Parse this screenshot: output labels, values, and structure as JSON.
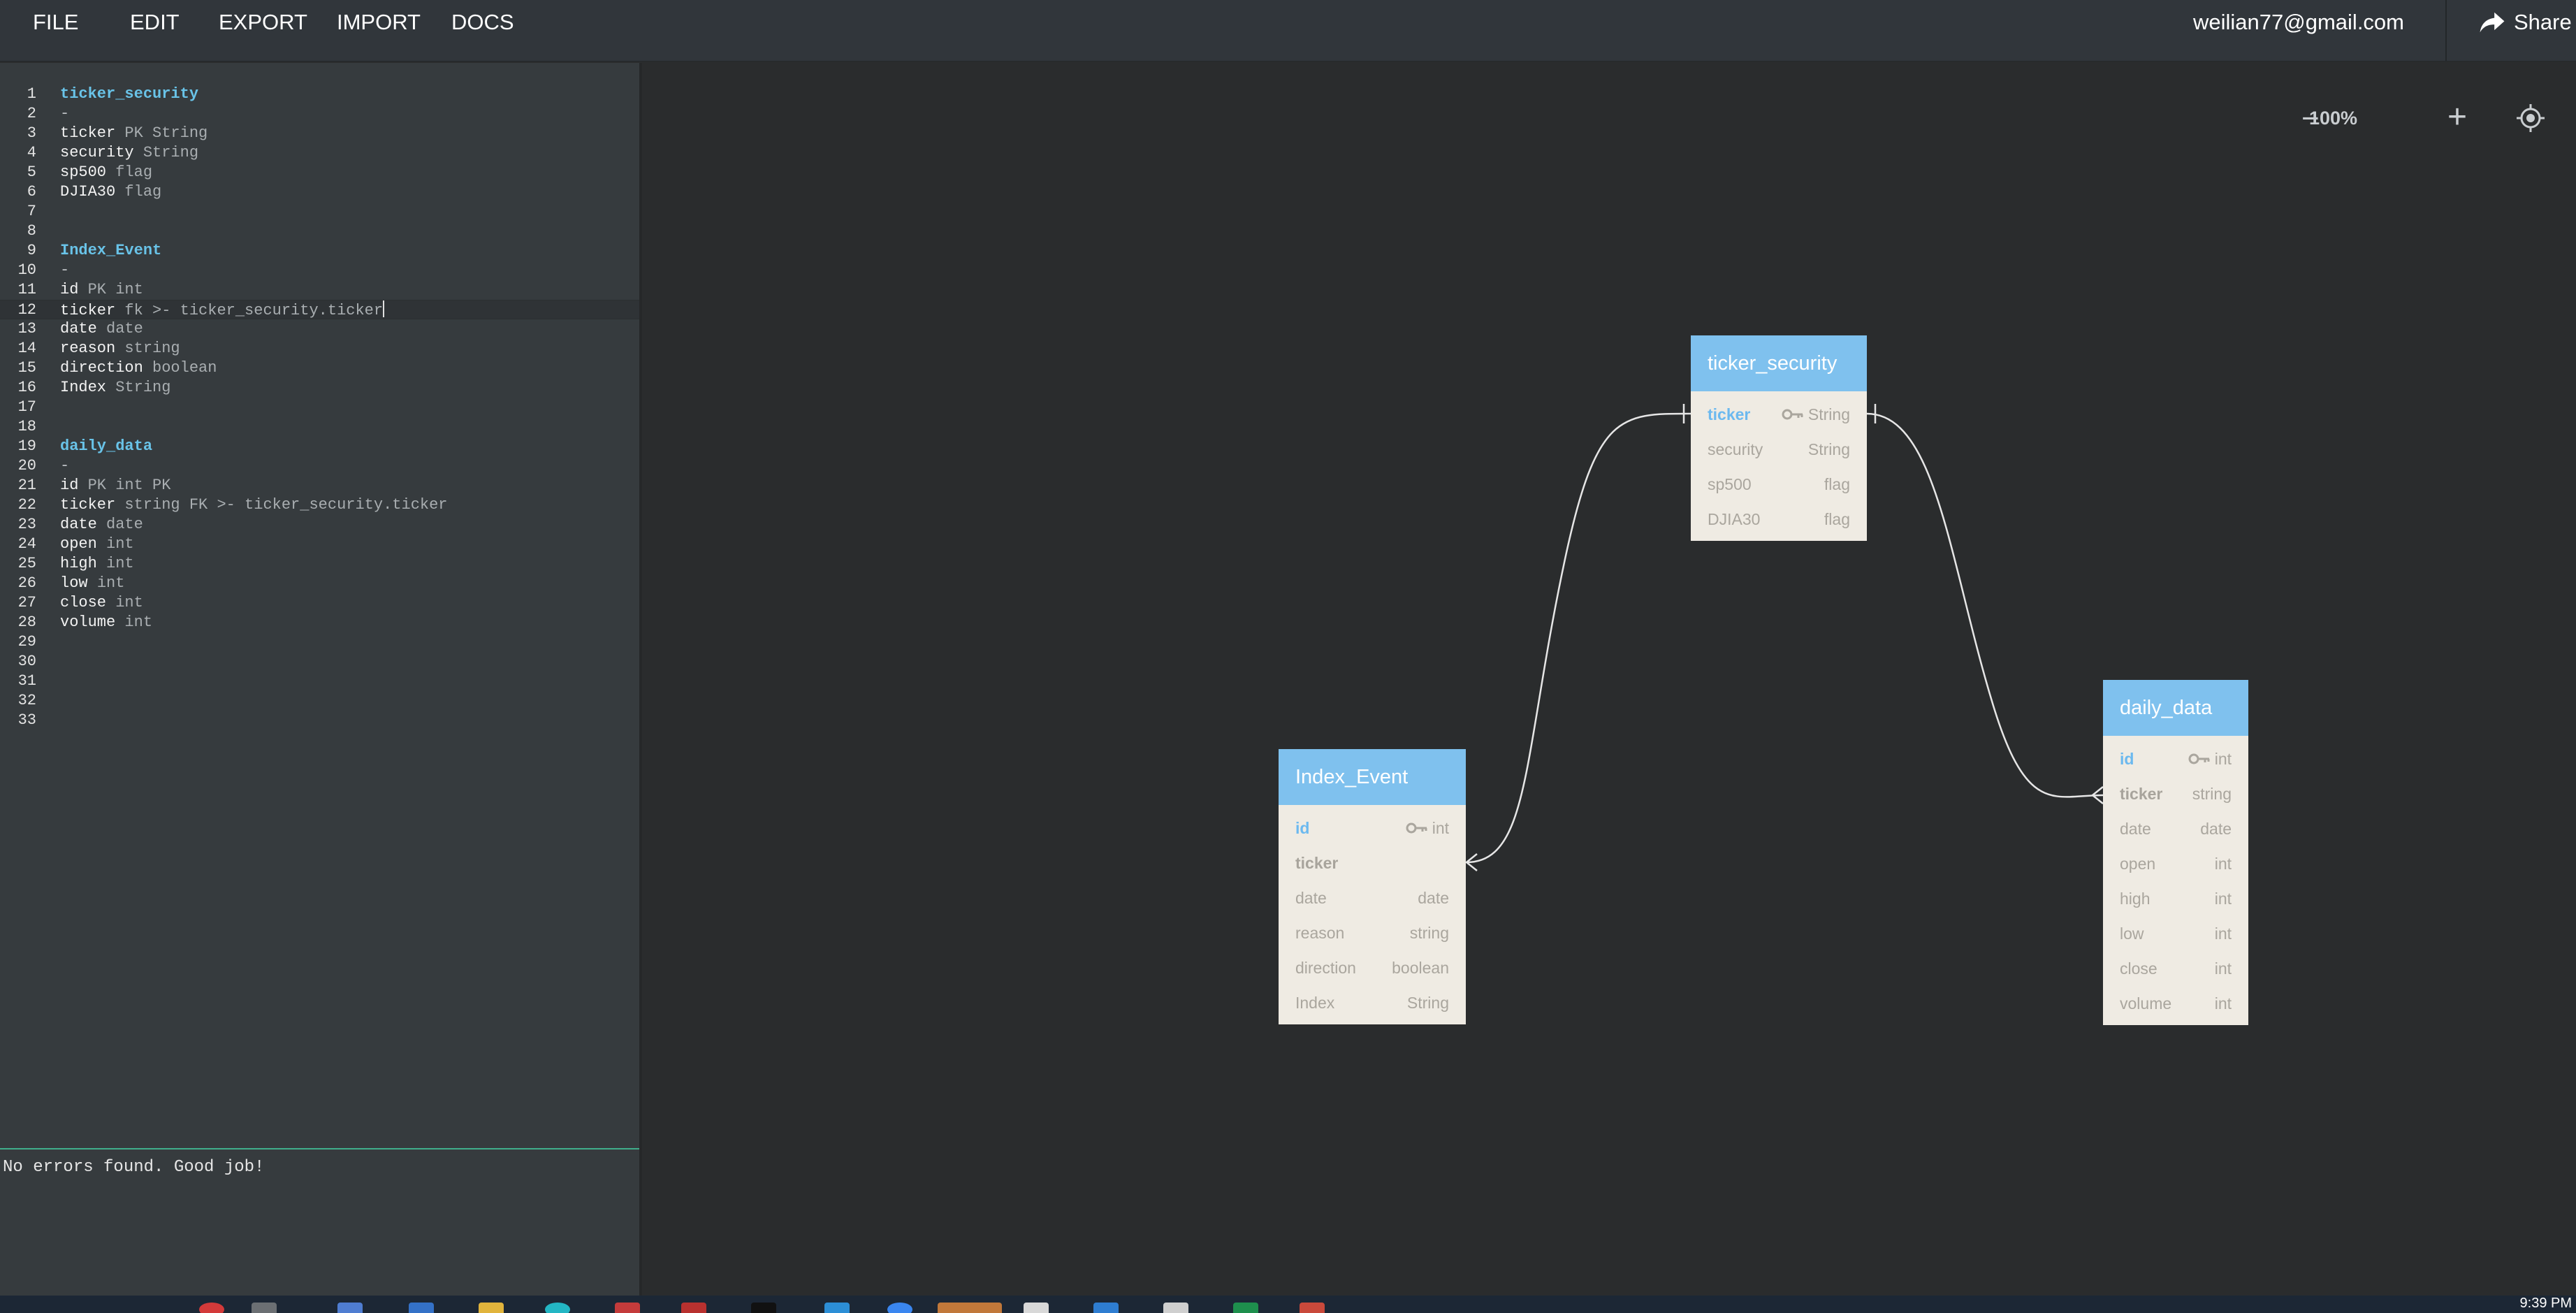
{
  "menu": {
    "file": "FILE",
    "edit": "EDIT",
    "export": "EXPORT",
    "import": "IMPORT",
    "docs": "DOCS"
  },
  "user": {
    "email": "weilian77@gmail.com"
  },
  "share": {
    "label": "Share",
    "icon": "share-arrow-icon"
  },
  "editor": {
    "lines": [
      {
        "n": "1",
        "parts": [
          [
            "tbl",
            "ticker_security"
          ]
        ]
      },
      {
        "n": "2",
        "parts": [
          [
            "sep",
            "-"
          ]
        ]
      },
      {
        "n": "3",
        "parts": [
          [
            "txt",
            "ticker "
          ],
          [
            "dim",
            "PK String"
          ]
        ]
      },
      {
        "n": "4",
        "parts": [
          [
            "txt",
            "security "
          ],
          [
            "dim",
            "String"
          ]
        ]
      },
      {
        "n": "5",
        "parts": [
          [
            "txt",
            "sp500 "
          ],
          [
            "dim",
            "flag"
          ]
        ]
      },
      {
        "n": "6",
        "parts": [
          [
            "txt",
            "DJIA30 "
          ],
          [
            "dim",
            "flag"
          ]
        ]
      },
      {
        "n": "7",
        "parts": []
      },
      {
        "n": "8",
        "parts": []
      },
      {
        "n": "9",
        "parts": [
          [
            "tbl",
            "Index_Event"
          ]
        ]
      },
      {
        "n": "10",
        "parts": [
          [
            "sep",
            "-"
          ]
        ]
      },
      {
        "n": "11",
        "parts": [
          [
            "txt",
            "id "
          ],
          [
            "dim",
            "PK int"
          ]
        ]
      },
      {
        "n": "12",
        "parts": [
          [
            "txt",
            "ticker "
          ],
          [
            "dim",
            "fk >- ticker_security.ticker"
          ]
        ],
        "active": true
      },
      {
        "n": "13",
        "parts": [
          [
            "txt",
            "date "
          ],
          [
            "dim",
            "date"
          ]
        ]
      },
      {
        "n": "14",
        "parts": [
          [
            "txt",
            "reason "
          ],
          [
            "dim",
            "string"
          ]
        ]
      },
      {
        "n": "15",
        "parts": [
          [
            "txt",
            "direction "
          ],
          [
            "dim",
            "boolean"
          ]
        ]
      },
      {
        "n": "16",
        "parts": [
          [
            "txt",
            "Index "
          ],
          [
            "dim",
            "String"
          ]
        ]
      },
      {
        "n": "17",
        "parts": []
      },
      {
        "n": "18",
        "parts": []
      },
      {
        "n": "19",
        "parts": [
          [
            "tbl",
            "daily_data"
          ]
        ]
      },
      {
        "n": "20",
        "parts": [
          [
            "sep",
            "-"
          ]
        ]
      },
      {
        "n": "21",
        "parts": [
          [
            "txt",
            "id "
          ],
          [
            "dim",
            "PK int PK"
          ]
        ]
      },
      {
        "n": "22",
        "parts": [
          [
            "txt",
            "ticker "
          ],
          [
            "dim",
            "string FK >- ticker_security.ticker"
          ]
        ]
      },
      {
        "n": "23",
        "parts": [
          [
            "txt",
            "date "
          ],
          [
            "dim",
            "date"
          ]
        ]
      },
      {
        "n": "24",
        "parts": [
          [
            "txt",
            "open "
          ],
          [
            "dim",
            "int"
          ]
        ]
      },
      {
        "n": "25",
        "parts": [
          [
            "txt",
            "high "
          ],
          [
            "dim",
            "int"
          ]
        ]
      },
      {
        "n": "26",
        "parts": [
          [
            "txt",
            "low "
          ],
          [
            "dim",
            "int"
          ]
        ]
      },
      {
        "n": "27",
        "parts": [
          [
            "txt",
            "close "
          ],
          [
            "dim",
            "int"
          ]
        ]
      },
      {
        "n": "28",
        "parts": [
          [
            "txt",
            "volume "
          ],
          [
            "dim",
            "int"
          ]
        ]
      },
      {
        "n": "29",
        "parts": []
      },
      {
        "n": "30",
        "parts": []
      },
      {
        "n": "31",
        "parts": []
      },
      {
        "n": "32",
        "parts": []
      },
      {
        "n": "33",
        "parts": []
      }
    ]
  },
  "status": {
    "message": "No errors found. Good job!"
  },
  "zoom": {
    "level": "100%",
    "minus": "−",
    "plus": "+",
    "locate_icon": "locate-icon"
  },
  "tables": {
    "ticker_security": {
      "title": "ticker_security",
      "rows": [
        {
          "field": "ticker",
          "type": "String",
          "pk": true
        },
        {
          "field": "security",
          "type": "String"
        },
        {
          "field": "sp500",
          "type": "flag"
        },
        {
          "field": "DJIA30",
          "type": "flag"
        }
      ]
    },
    "index_event": {
      "title": "Index_Event",
      "rows": [
        {
          "field": "id",
          "type": "int",
          "pk": true
        },
        {
          "field": "ticker",
          "type": "",
          "fk": true
        },
        {
          "field": "date",
          "type": "date"
        },
        {
          "field": "reason",
          "type": "string"
        },
        {
          "field": "direction",
          "type": "boolean"
        },
        {
          "field": "Index",
          "type": "String"
        }
      ]
    },
    "daily_data": {
      "title": "daily_data",
      "rows": [
        {
          "field": "id",
          "type": "int",
          "pk": true
        },
        {
          "field": "ticker",
          "type": "string",
          "fk": true
        },
        {
          "field": "date",
          "type": "date"
        },
        {
          "field": "open",
          "type": "int"
        },
        {
          "field": "high",
          "type": "int"
        },
        {
          "field": "low",
          "type": "int"
        },
        {
          "field": "close",
          "type": "int"
        },
        {
          "field": "volume",
          "type": "int"
        }
      ]
    }
  },
  "taskbar": {
    "clock": "9:39 PM"
  }
}
